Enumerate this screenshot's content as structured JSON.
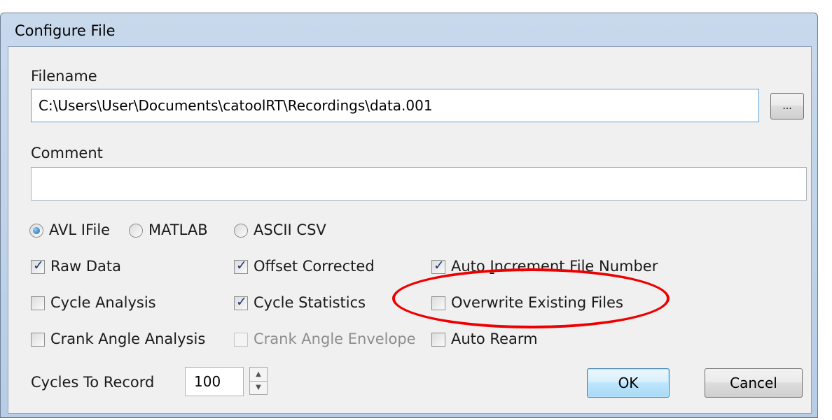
{
  "window": {
    "title": "Configure File"
  },
  "filename": {
    "label": "Filename",
    "value": "C:\\Users\\User\\Documents\\catoolRT\\Recordings\\data.001",
    "browse_label": "..."
  },
  "comment": {
    "label": "Comment",
    "value": ""
  },
  "format": {
    "options": [
      {
        "label": "AVL IFile",
        "selected": true
      },
      {
        "label": "MATLAB",
        "selected": false
      },
      {
        "label": "ASCII CSV",
        "selected": false
      }
    ]
  },
  "checkboxes": {
    "raw_data": {
      "label": "Raw Data",
      "checked": true
    },
    "offset_corrected": {
      "label": "Offset Corrected",
      "checked": true
    },
    "auto_increment": {
      "label_pre": "Auto ",
      "label_u": "I",
      "label_post": "ncrement File Number",
      "checked": true
    },
    "cycle_analysis": {
      "label": "Cycle Analysis",
      "checked": false
    },
    "cycle_statistics": {
      "label": "Cycle Statistics",
      "checked": true
    },
    "overwrite_existing": {
      "label": "Overwrite Existing Files",
      "checked": false
    },
    "crank_angle_analysis": {
      "label": "Crank Angle Analysis",
      "checked": false
    },
    "crank_angle_envelope": {
      "label": "Crank Angle Envelope",
      "checked": false,
      "disabled": true
    },
    "auto_rearm": {
      "label": "Auto Rearm",
      "checked": false
    }
  },
  "cycles": {
    "label": "Cycles To Record",
    "value": "100"
  },
  "buttons": {
    "ok": "OK",
    "cancel": "Cancel"
  },
  "annotation": {
    "color": "#ee0000"
  }
}
